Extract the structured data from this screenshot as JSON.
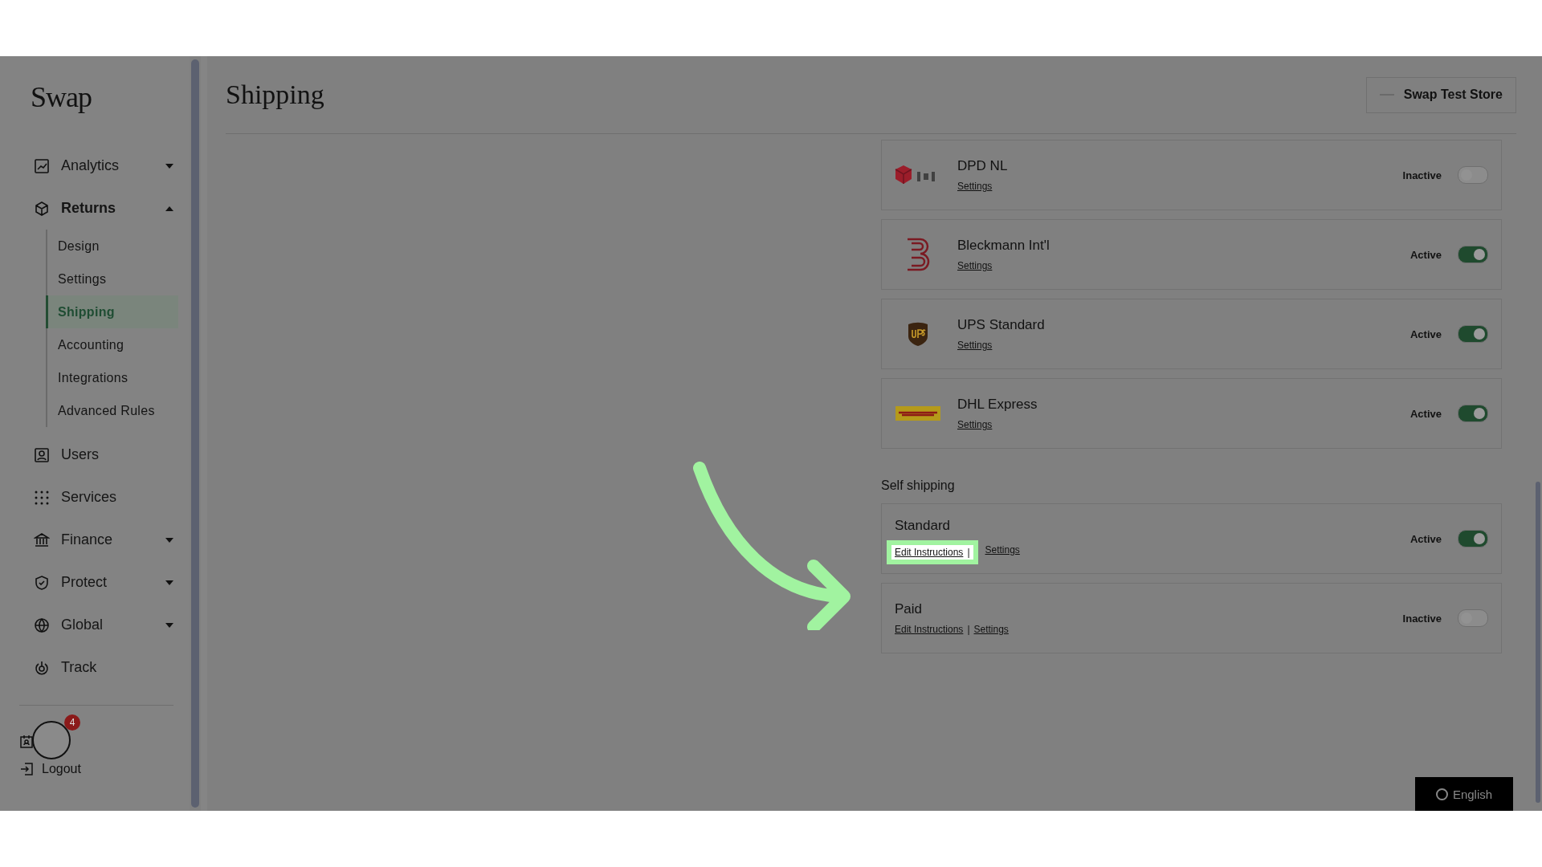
{
  "brand": "Swap",
  "nav": [
    {
      "label": "Analytics",
      "expanded": false,
      "caret": true
    },
    {
      "label": "Returns",
      "expanded": true,
      "caret": true,
      "children": [
        {
          "label": "Design",
          "selected": false
        },
        {
          "label": "Settings",
          "selected": false
        },
        {
          "label": "Shipping",
          "selected": true
        },
        {
          "label": "Accounting",
          "selected": false
        },
        {
          "label": "Integrations",
          "selected": false
        },
        {
          "label": "Advanced Rules",
          "selected": false
        }
      ]
    },
    {
      "label": "Users",
      "caret": false
    },
    {
      "label": "Services",
      "caret": false
    },
    {
      "label": "Finance",
      "expanded": false,
      "caret": true
    },
    {
      "label": "Protect",
      "expanded": false,
      "caret": true
    },
    {
      "label": "Global",
      "expanded": false,
      "caret": true
    },
    {
      "label": "Track",
      "caret": false
    }
  ],
  "footer": {
    "logout": "Logout",
    "badge": "4"
  },
  "page_title": "Shipping",
  "store": "Swap Test Store",
  "carriers": [
    {
      "name": "DPD NL",
      "link": "Settings",
      "status": "Inactive",
      "on": false
    },
    {
      "name": "Bleckmann Int'l",
      "link": "Settings",
      "status": "Active",
      "on": true
    },
    {
      "name": "UPS Standard",
      "link": "Settings",
      "status": "Active",
      "on": true
    },
    {
      "name": "DHL Express",
      "link": "Settings",
      "status": "Active",
      "on": true
    }
  ],
  "self_shipping": {
    "title": "Self shipping",
    "options": [
      {
        "name": "Standard",
        "edit": "Edit Instructions",
        "separator": "|",
        "link": "Settings",
        "status": "Active",
        "on": true,
        "highlighted": true
      },
      {
        "name": "Paid",
        "edit": "Edit Instructions",
        "separator": "|",
        "link": "Settings",
        "status": "Inactive",
        "on": false,
        "highlighted": false
      }
    ]
  },
  "language": "English"
}
